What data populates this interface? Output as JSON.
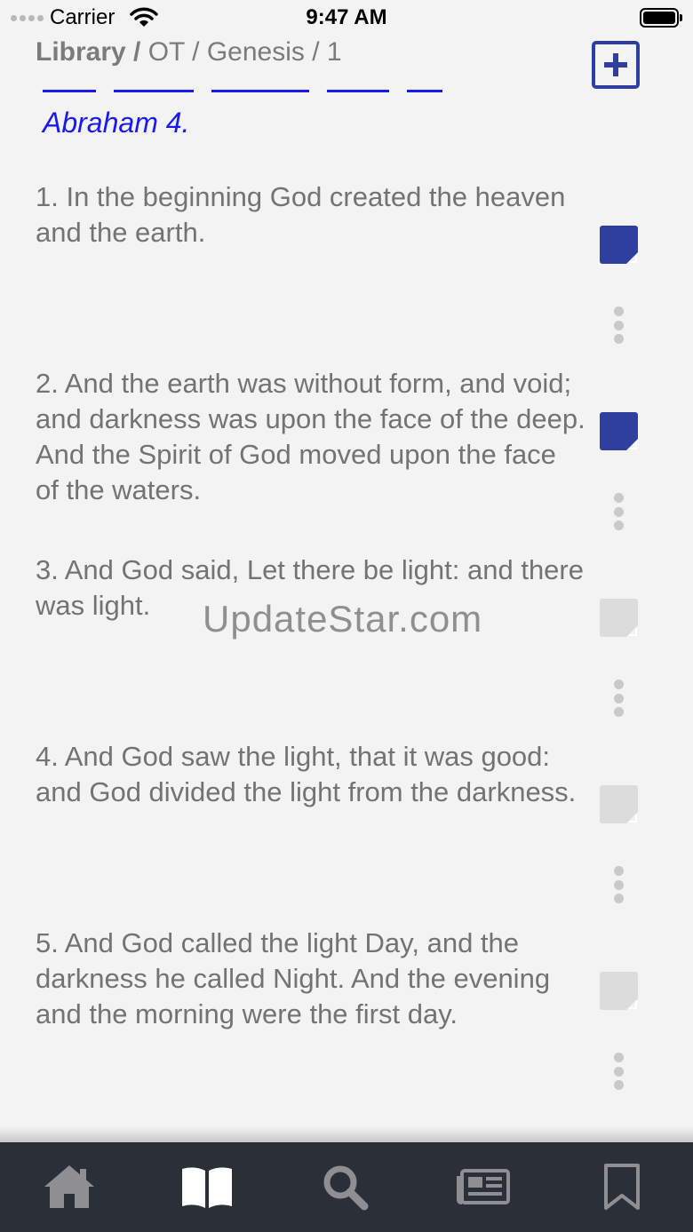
{
  "status_bar": {
    "carrier": "Carrier",
    "time": "9:47 AM"
  },
  "header": {
    "breadcrumb_library": "Library /",
    "breadcrumb_rest": " OT / Genesis  / 1",
    "add_icon": "plus-square-icon",
    "accent_color": "#2e3fa0"
  },
  "cross_reference": "Abraham 4.",
  "verses": [
    {
      "text": "1. In the beginning God created the heaven and the earth.",
      "note_active": true
    },
    {
      "text": "2. And the earth was without form, and void; and darkness was upon the face of the deep. And the Spirit of God moved upon the face of the waters.",
      "note_active": true
    },
    {
      "text": "3. And God said, Let there be light: and there was light.",
      "note_active": false
    },
    {
      "text": "4. And God saw the light, that it was good: and God divided the light from the darkness.",
      "note_active": false
    },
    {
      "text": "5. And God called the light Day, and the darkness he called Night. And the evening and the morning were the first day.",
      "note_active": false
    }
  ],
  "watermark": "UpdateStar.com",
  "tab_bar": {
    "items": [
      {
        "icon": "home-icon",
        "selected": false
      },
      {
        "icon": "book-open-icon",
        "selected": true
      },
      {
        "icon": "search-icon",
        "selected": false
      },
      {
        "icon": "newspaper-icon",
        "selected": false
      },
      {
        "icon": "bookmark-icon",
        "selected": false
      }
    ],
    "background": "#2b2f37",
    "icon_color": "#8e8e93",
    "selected_color": "#ffffff"
  }
}
